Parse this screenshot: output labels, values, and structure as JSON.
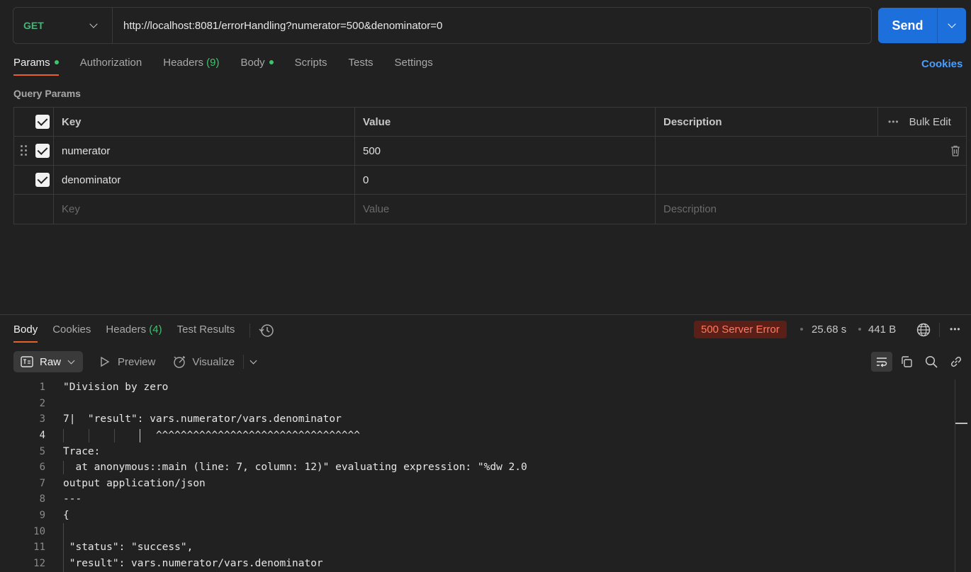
{
  "request": {
    "method": "GET",
    "url": "http://localhost:8081/errorHandling?numerator=500&denominator=0",
    "send_label": "Send"
  },
  "request_tabs": [
    {
      "label": "Params",
      "dot": true,
      "active": true
    },
    {
      "label": "Authorization"
    },
    {
      "label": "Headers",
      "count": "(9)"
    },
    {
      "label": "Body",
      "dot": true
    },
    {
      "label": "Scripts"
    },
    {
      "label": "Tests"
    },
    {
      "label": "Settings"
    }
  ],
  "cookies_link": "Cookies",
  "query_params": {
    "title": "Query Params",
    "headers": {
      "key": "Key",
      "value": "Value",
      "description": "Description",
      "bulk_edit": "Bulk Edit"
    },
    "rows": [
      {
        "key": "numerator",
        "value": "500",
        "enabled": true
      },
      {
        "key": "denominator",
        "value": "0",
        "enabled": true
      }
    ],
    "placeholders": {
      "key": "Key",
      "value": "Value",
      "description": "Description"
    }
  },
  "response_tabs": [
    {
      "label": "Body",
      "active": true
    },
    {
      "label": "Cookies"
    },
    {
      "label": "Headers",
      "count": "(4)"
    },
    {
      "label": "Test Results"
    }
  ],
  "response_meta": {
    "status": "500 Server Error",
    "time": "25.68 s",
    "size": "441 B",
    "status_color": "#ff7a63"
  },
  "response_toolbar": {
    "raw": "Raw",
    "preview": "Preview",
    "visualize": "Visualize"
  },
  "code_lines": [
    {
      "n": "1",
      "text": "\"Division by zero"
    },
    {
      "n": "2",
      "text": ""
    },
    {
      "n": "3",
      "text": "7|  \"result\": vars.numerator/vars.denominator"
    },
    {
      "n": "4",
      "text": "               ^^^^^^^^^^^^^^^^^^^^^^^^^^^^^^^^^"
    },
    {
      "n": "5",
      "text": "Trace:"
    },
    {
      "n": "6",
      "text": "  at anonymous::main (line: 7, column: 12)\" evaluating expression: \"%dw 2.0"
    },
    {
      "n": "7",
      "text": "output application/json"
    },
    {
      "n": "8",
      "text": "---"
    },
    {
      "n": "9",
      "text": "{"
    },
    {
      "n": "10",
      "text": ""
    },
    {
      "n": "11",
      "text": " \"status\": \"success\","
    },
    {
      "n": "12",
      "text": " \"result\": vars.numerator/vars.denominator"
    }
  ],
  "colors": {
    "accent": "#1d6fdc",
    "method": "#49b37a",
    "tab_underline": "#e5602b",
    "link": "#4a9eff"
  }
}
